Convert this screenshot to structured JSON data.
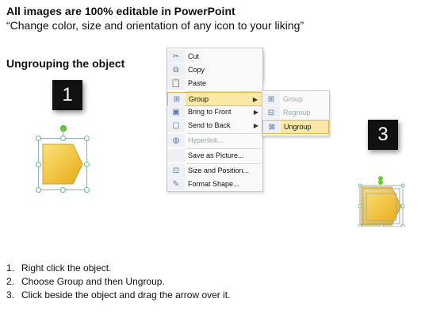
{
  "header": {
    "title": "All images are 100% editable in PowerPoint",
    "subtitle": "“Change color, size and orientation of any icon to your liking”"
  },
  "section": {
    "title": "Ungrouping the object"
  },
  "step_numbers": [
    "1",
    "2",
    "3"
  ],
  "context_menu": {
    "items": [
      {
        "label": "Cut",
        "icon": "scissors-icon",
        "glyph": "✂"
      },
      {
        "label": "Copy",
        "icon": "copy-icon",
        "glyph": "⧉"
      },
      {
        "label": "Paste",
        "icon": "paste-icon",
        "glyph": "📋"
      },
      {
        "label": "Group",
        "icon": "group-icon",
        "glyph": "⊞",
        "submenu": true,
        "highlighted": true
      },
      {
        "label": "Bring to Front",
        "icon": "bring-to-front-icon",
        "glyph": "▣",
        "submenu": true
      },
      {
        "label": "Send to Back",
        "icon": "send-to-back-icon",
        "glyph": "▢",
        "submenu": true
      },
      {
        "label": "Hyperlink...",
        "icon": "hyperlink-icon",
        "glyph": "◍",
        "disabled": true
      },
      {
        "label": "Save as Picture...",
        "icon": "",
        "glyph": ""
      },
      {
        "label": "Size and Position...",
        "icon": "size-position-icon",
        "glyph": "⊡"
      },
      {
        "label": "Format Shape...",
        "icon": "format-shape-icon",
        "glyph": "✎"
      }
    ]
  },
  "submenu": {
    "items": [
      {
        "label": "Group",
        "icon": "group-icon",
        "glyph": "⊞",
        "disabled": true
      },
      {
        "label": "Regroup",
        "icon": "regroup-icon",
        "glyph": "⊟",
        "disabled": true
      },
      {
        "label": "Ungroup",
        "icon": "ungroup-icon",
        "glyph": "⊠",
        "highlighted": true
      }
    ]
  },
  "instructions": [
    {
      "num": "1.",
      "text": "Right click the object."
    },
    {
      "num": "2.",
      "text": "Choose Group and then Ungroup."
    },
    {
      "num": "3.",
      "text": "Click beside the object and drag the arrow over it."
    }
  ],
  "colors": {
    "shape_fill": "#f5c22a",
    "shape_light": "#fbe27a",
    "highlight": "#fbe7a6"
  }
}
